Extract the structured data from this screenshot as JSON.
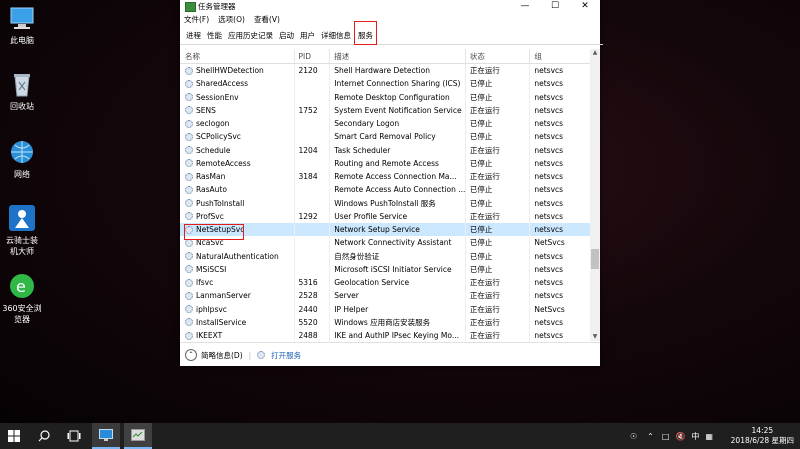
{
  "desktop_icons": [
    {
      "label": "此电脑",
      "icon": "computer-icon"
    },
    {
      "label": "回收站",
      "icon": "recycle-bin-icon"
    },
    {
      "label": "网络",
      "icon": "network-icon"
    },
    {
      "label": "云骑士装机大师",
      "icon": "yunqishi-app-icon"
    },
    {
      "label": "360安全浏览器",
      "icon": "360-browser-icon"
    }
  ],
  "window": {
    "title": "任务管理器",
    "menu": [
      "文件(F)",
      "选项(O)",
      "查看(V)"
    ],
    "tabs": [
      "进程",
      "性能",
      "应用历史记录",
      "启动",
      "用户",
      "详细信息",
      "服务"
    ],
    "active_tab": "服务"
  },
  "table": {
    "columns": [
      "名称",
      "PID",
      "描述",
      "状态",
      "组"
    ],
    "rows": [
      {
        "name": "ShellHWDetection",
        "pid": "2120",
        "desc": "Shell Hardware Detection",
        "status": "正在运行",
        "group": "netsvcs"
      },
      {
        "name": "SharedAccess",
        "pid": "",
        "desc": "Internet Connection Sharing (ICS)",
        "status": "已停止",
        "group": "netsvcs"
      },
      {
        "name": "SessionEnv",
        "pid": "",
        "desc": "Remote Desktop Configuration",
        "status": "已停止",
        "group": "netsvcs"
      },
      {
        "name": "SENS",
        "pid": "1752",
        "desc": "System Event Notification Service",
        "status": "正在运行",
        "group": "netsvcs"
      },
      {
        "name": "seclogon",
        "pid": "",
        "desc": "Secondary Logon",
        "status": "已停止",
        "group": "netsvcs"
      },
      {
        "name": "SCPolicySvc",
        "pid": "",
        "desc": "Smart Card Removal Policy",
        "status": "已停止",
        "group": "netsvcs"
      },
      {
        "name": "Schedule",
        "pid": "1204",
        "desc": "Task Scheduler",
        "status": "正在运行",
        "group": "netsvcs"
      },
      {
        "name": "RemoteAccess",
        "pid": "",
        "desc": "Routing and Remote Access",
        "status": "已停止",
        "group": "netsvcs"
      },
      {
        "name": "RasMan",
        "pid": "3184",
        "desc": "Remote Access Connection Ma...",
        "status": "正在运行",
        "group": "netsvcs"
      },
      {
        "name": "RasAuto",
        "pid": "",
        "desc": "Remote Access Auto Connection ...",
        "status": "已停止",
        "group": "netsvcs"
      },
      {
        "name": "PushToInstall",
        "pid": "",
        "desc": "Windows PushToInstall 服务",
        "status": "已停止",
        "group": "netsvcs"
      },
      {
        "name": "ProfSvc",
        "pid": "1292",
        "desc": "User Profile Service",
        "status": "正在运行",
        "group": "netsvcs"
      },
      {
        "name": "NetSetupSvc",
        "pid": "",
        "desc": "Network Setup Service",
        "status": "已停止",
        "group": "netsvcs"
      },
      {
        "name": "NcaSvc",
        "pid": "",
        "desc": "Network Connectivity Assistant",
        "status": "已停止",
        "group": "NetSvcs"
      },
      {
        "name": "NaturalAuthentication",
        "pid": "",
        "desc": "自然身份验证",
        "status": "已停止",
        "group": "netsvcs"
      },
      {
        "name": "MSiSCSI",
        "pid": "",
        "desc": "Microsoft iSCSI Initiator Service",
        "status": "已停止",
        "group": "netsvcs"
      },
      {
        "name": "lfsvc",
        "pid": "5316",
        "desc": "Geolocation Service",
        "status": "正在运行",
        "group": "netsvcs"
      },
      {
        "name": "LanmanServer",
        "pid": "2528",
        "desc": "Server",
        "status": "正在运行",
        "group": "netsvcs"
      },
      {
        "name": "iphlpsvc",
        "pid": "2440",
        "desc": "IP Helper",
        "status": "正在运行",
        "group": "NetSvcs"
      },
      {
        "name": "InstallService",
        "pid": "5520",
        "desc": "Windows 应用商店安装服务",
        "status": "正在运行",
        "group": "netsvcs"
      },
      {
        "name": "IKEEXT",
        "pid": "2488",
        "desc": "IKE and AuthIP IPsec Keying Mo...",
        "status": "正在运行",
        "group": "netsvcs"
      }
    ],
    "selected_row": "NetSetupSvc"
  },
  "statusbar": {
    "fewer_details": "简略信息(D)",
    "open_services": "打开服务"
  },
  "taskbar": {
    "time": "14:25",
    "date": "2018/6/28 星期四",
    "ime": "中"
  },
  "colors": {
    "highlight": "#e51c1c",
    "selection": "#cce8ff",
    "link": "#1a5fb4"
  }
}
